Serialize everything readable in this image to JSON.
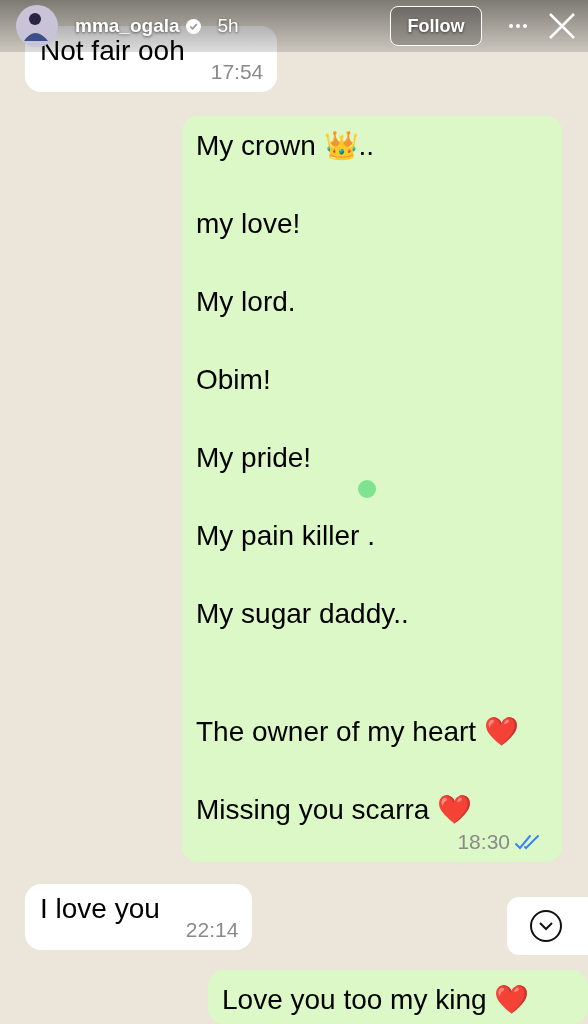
{
  "story_header": {
    "username": "mma_ogala",
    "verified": true,
    "age": "5h",
    "follow_label": "Follow"
  },
  "messages": [
    {
      "kind": "incoming",
      "blocks": [
        [
          "Not fair ooh"
        ]
      ],
      "time": "17:54"
    },
    {
      "kind": "outgoing",
      "blocks": [
        [
          "My crown 👑..",
          "my love!",
          "My lord.",
          "Obim!",
          "My pride!",
          "My pain killer .",
          "My sugar daddy.."
        ],
        [
          "The owner of my heart ❤️",
          "Missing you scarra ❤️"
        ]
      ],
      "time": "18:30",
      "read": true
    },
    {
      "kind": "incoming",
      "blocks": [
        [
          "I love you"
        ]
      ],
      "time": "22:14"
    },
    {
      "kind": "outgoing",
      "blocks": [
        [
          "Love you too my king ❤️"
        ]
      ]
    }
  ]
}
